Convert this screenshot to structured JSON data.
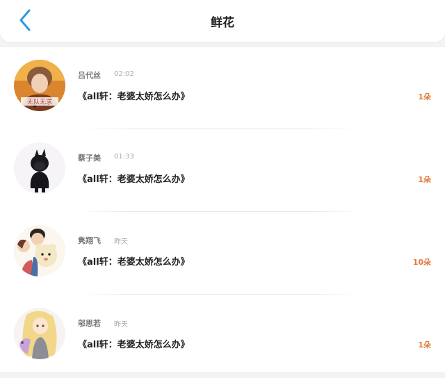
{
  "header": {
    "title": "鲜花",
    "back_icon": "chevron-left-icon",
    "accent_color": "#2b9be6"
  },
  "items": [
    {
      "name": "吕代丝",
      "time": "02:02",
      "book": "《all轩：老婆太娇怎么办》",
      "count": "1朵",
      "avatar_text": "无队无求"
    },
    {
      "name": "蔡子美",
      "time": "01:33",
      "book": "《all轩：老婆太娇怎么办》",
      "count": "1朵"
    },
    {
      "name": "隽翔飞",
      "time": "昨天",
      "book": "《all轩：老婆太娇怎么办》",
      "count": "10朵"
    },
    {
      "name": "邬思若",
      "time": "昨天",
      "book": "《all轩：老婆太娇怎么办》",
      "count": "1朵"
    }
  ],
  "count_color": "#e07a3a"
}
